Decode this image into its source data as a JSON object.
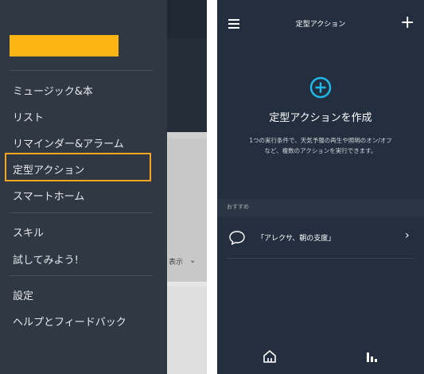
{
  "drawer": {
    "menu_items": [
      {
        "label": "ミュージック&本"
      },
      {
        "label": "リスト"
      },
      {
        "label": "リマインダー&アラーム"
      },
      {
        "label": "定型アクション",
        "selected": true
      },
      {
        "label": "スマートホーム"
      },
      {
        "label": "スキル"
      },
      {
        "label": "試してみよう!"
      },
      {
        "label": "設定"
      },
      {
        "label": "ヘルプとフィードバック"
      }
    ],
    "background_partial_text": "表示",
    "highlight_color": "#f6a623",
    "redaction_color": "#fcb514"
  },
  "routines": {
    "title": "定型アクション",
    "create_title": "定型アクションを作成",
    "create_description": "1つの実行条件で、天気予報の再生や照明のオン/オフなど、複数のアクションを実行できます。",
    "recommended_label": "おすすめ",
    "recommended_items": [
      {
        "label": "「アレクサ、朝の支度」"
      }
    ],
    "accent_color": "#1fb8e8"
  },
  "icons": {
    "menu": "hamburger-icon",
    "add": "plus-icon",
    "create": "add-circle-icon",
    "bubble": "speech-bubble-icon",
    "chevron": "chevron-right-icon",
    "home": "home-icon",
    "activity": "activity-icon"
  }
}
